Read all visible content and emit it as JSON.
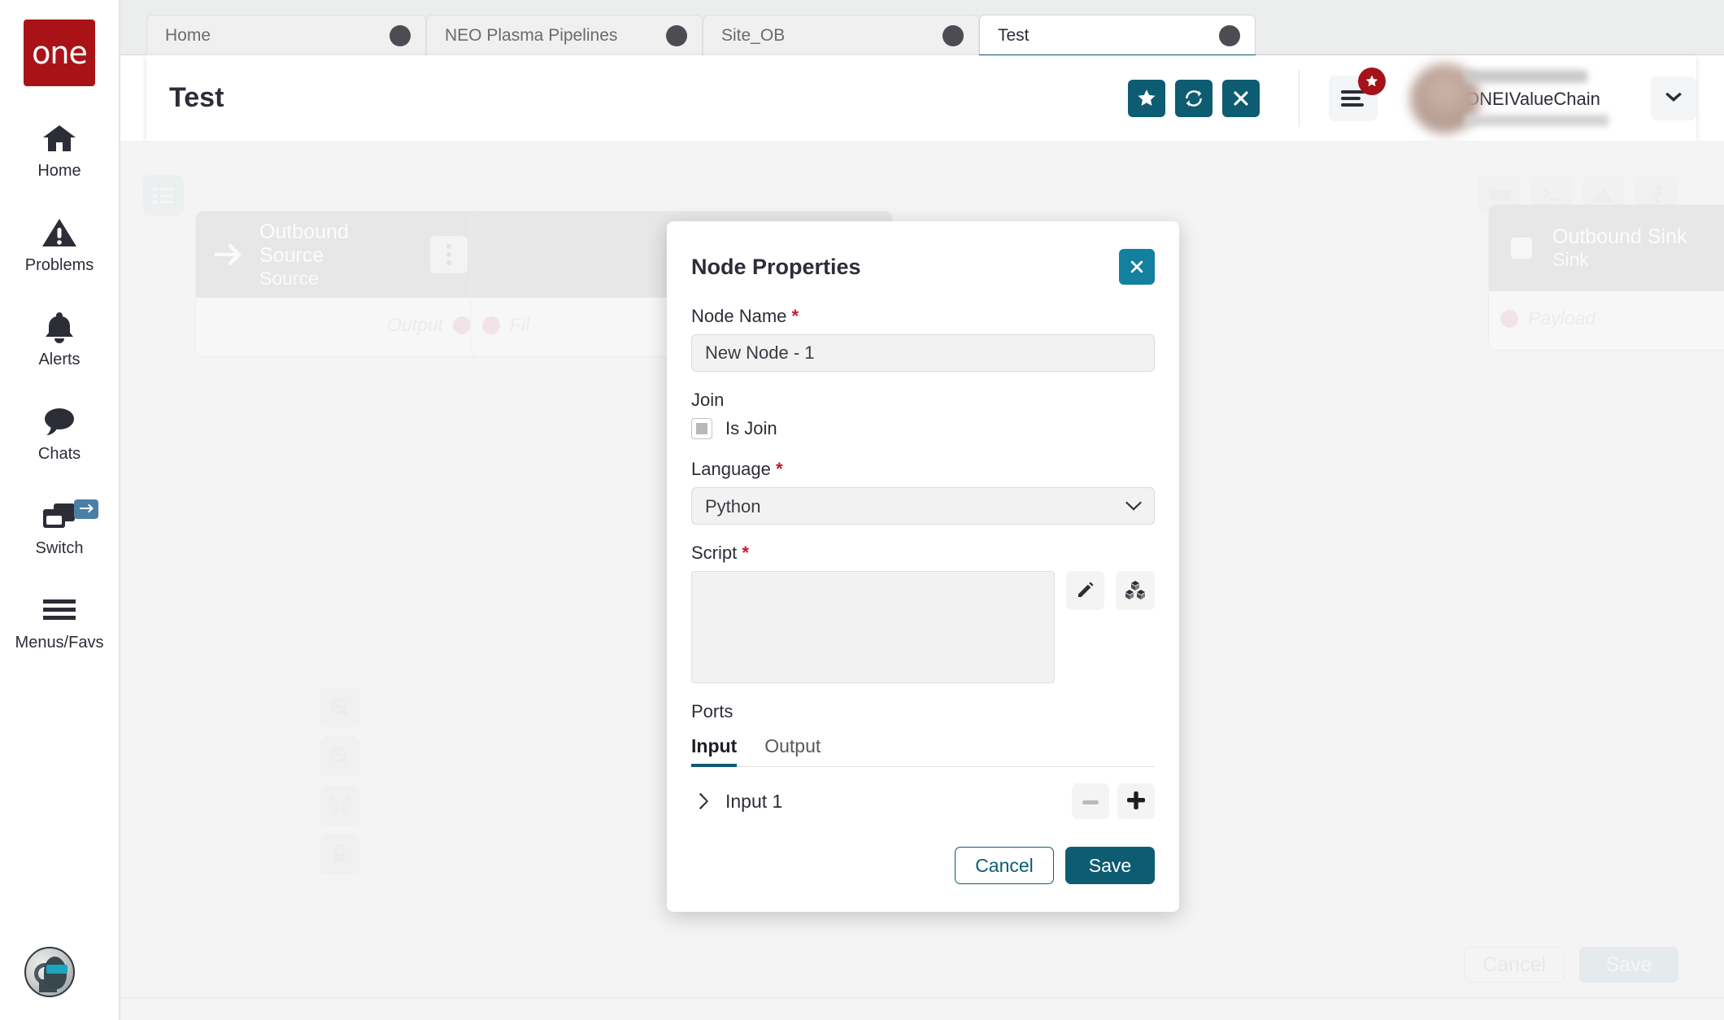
{
  "brand": {
    "logo_text": "one",
    "accent": "#0d5c71",
    "logo_bg": "#a91318",
    "required_color": "#c91a22"
  },
  "sidebar": {
    "items": [
      {
        "label": "Home",
        "icon": "home-icon"
      },
      {
        "label": "Problems",
        "icon": "warning-triangle-icon"
      },
      {
        "label": "Alerts",
        "icon": "bell-icon"
      },
      {
        "label": "Chats",
        "icon": "chat-bubble-icon"
      },
      {
        "label": "Switch",
        "icon": "windows-stack-icon",
        "badge_icon": "swap-arrows-icon"
      },
      {
        "label": "Menus/Favs",
        "icon": "hamburger-icon"
      }
    ],
    "assistant": {
      "name": "ai-assistant-avatar"
    }
  },
  "tabs": [
    {
      "label": "Home",
      "active": false,
      "closable": true
    },
    {
      "label": "NEO Plasma Pipelines",
      "active": false,
      "closable": true
    },
    {
      "label": "Site_OB",
      "active": false,
      "closable": true
    },
    {
      "label": "Test",
      "active": true,
      "closable": true
    }
  ],
  "header": {
    "title": "Test",
    "actions": [
      {
        "name": "favorite-button",
        "icon": "star-icon"
      },
      {
        "name": "refresh-button",
        "icon": "refresh-icon"
      },
      {
        "name": "close-button",
        "icon": "close-x-icon"
      }
    ],
    "menu_button": {
      "icon": "menu-lines-icon",
      "badge_icon": "star-icon"
    },
    "user": {
      "org": "ONEIValueChain",
      "caret": "chevron-down-icon"
    }
  },
  "canvas": {
    "toolbar_left": [
      {
        "name": "list-view-button",
        "icon": "list-icon"
      }
    ],
    "toolbar_right": [
      {
        "name": "folder-button",
        "icon": "folder-icon"
      },
      {
        "name": "terminal-button",
        "icon": "terminal-icon"
      },
      {
        "name": "warnings-button",
        "icon": "warning-triangle-icon"
      },
      {
        "name": "run-button",
        "icon": "runner-icon"
      }
    ],
    "zoom_controls": [
      {
        "name": "zoom-in-button",
        "icon": "zoom-in-icon"
      },
      {
        "name": "zoom-out-button",
        "icon": "zoom-out-icon"
      },
      {
        "name": "fit-to-screen-button",
        "icon": "collapse-arrows-icon"
      },
      {
        "name": "lock-button",
        "icon": "unlock-icon"
      }
    ],
    "nodes": [
      {
        "title": "Outbound Source",
        "subtitle": "Source",
        "icon": "arrow-right-icon",
        "ports": [
          {
            "label": "Output",
            "side": "right"
          }
        ]
      },
      {
        "title": "",
        "subtitle": "",
        "icon": "",
        "ports": [
          {
            "label": "Fil",
            "side": "left"
          }
        ]
      },
      {
        "title": "Outbound Sink",
        "subtitle": "Sink",
        "icon": "square-icon",
        "ports": [
          {
            "label": "Payload",
            "side": "left"
          }
        ]
      }
    ],
    "footer_buttons": [
      {
        "name": "canvas-cancel-button",
        "label": "Cancel"
      },
      {
        "name": "canvas-save-button",
        "label": "Save"
      }
    ]
  },
  "modal": {
    "title": "Node Properties",
    "close_icon": "close-x-icon",
    "fields": {
      "node_name": {
        "label": "Node Name",
        "required": true,
        "value": "New Node - 1",
        "placeholder": ""
      },
      "join": {
        "label": "Join",
        "checkbox_label": "Is Join",
        "checked": false
      },
      "language": {
        "label": "Language",
        "required": true,
        "value": "Python",
        "options": [
          "Python"
        ]
      },
      "script": {
        "label": "Script",
        "required": true,
        "value": "",
        "placeholder": "",
        "buttons": [
          {
            "name": "edit-script-button",
            "icon": "pencil-icon"
          },
          {
            "name": "script-modules-button",
            "icon": "cubes-icon"
          }
        ]
      }
    },
    "ports": {
      "title": "Ports",
      "tabs": [
        {
          "label": "Input",
          "active": true
        },
        {
          "label": "Output",
          "active": false
        }
      ],
      "rows": [
        {
          "label": "Input 1",
          "expand_icon": "chevron-right-icon"
        }
      ],
      "row_actions": [
        {
          "name": "remove-port-button",
          "icon": "minus-icon"
        },
        {
          "name": "add-port-button",
          "icon": "plus-icon"
        }
      ]
    },
    "footer": {
      "cancel_label": "Cancel",
      "save_label": "Save"
    }
  }
}
